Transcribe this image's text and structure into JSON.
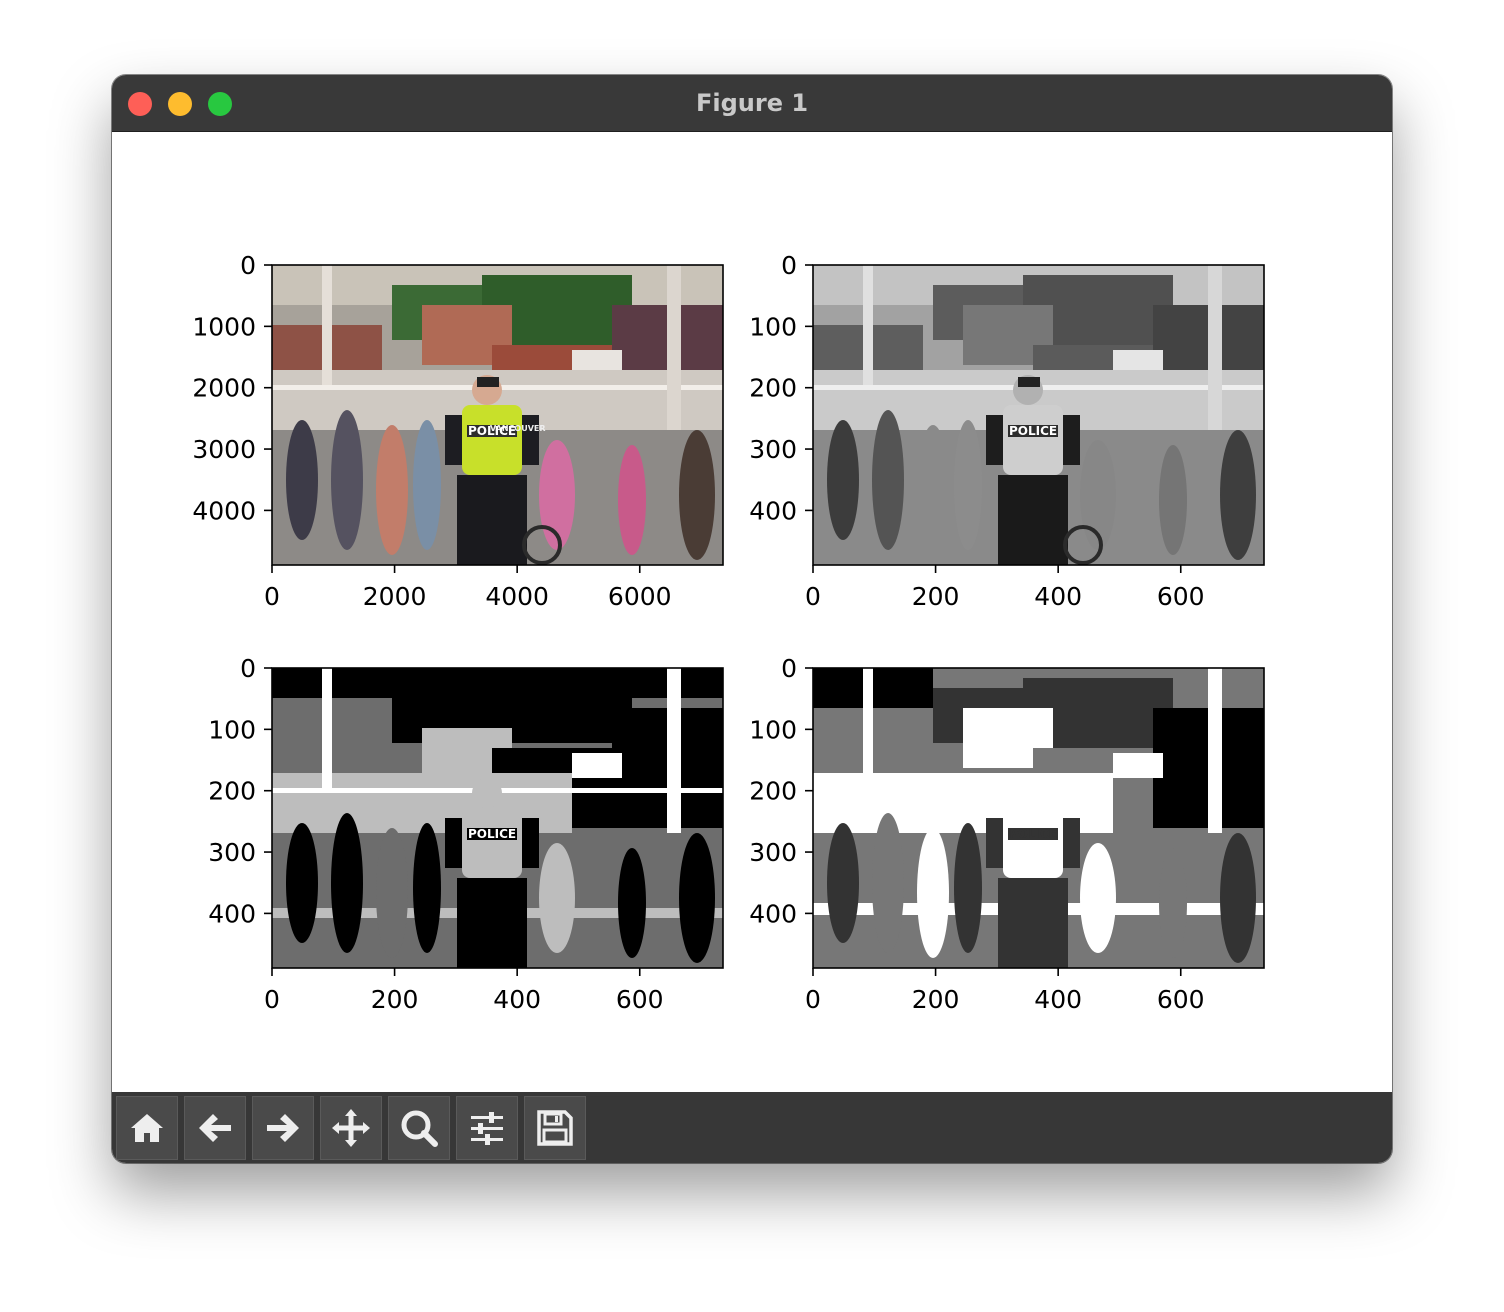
{
  "window": {
    "title": "Figure 1"
  },
  "toolbar": {
    "buttons": [
      {
        "name": "home-button",
        "icon": "home-icon"
      },
      {
        "name": "back-button",
        "icon": "arrow-left-icon"
      },
      {
        "name": "forward-button",
        "icon": "arrow-right-icon"
      },
      {
        "name": "pan-button",
        "icon": "move-icon"
      },
      {
        "name": "zoom-button",
        "icon": "magnifier-icon"
      },
      {
        "name": "configure-subplots-button",
        "icon": "sliders-icon"
      },
      {
        "name": "save-button",
        "icon": "floppy-disk-icon"
      }
    ]
  },
  "subplots": [
    {
      "image": "color photo: police officer in yellow vest among pedestrians",
      "x_ticks": [
        "0",
        "2000",
        "4000",
        "6000"
      ],
      "y_ticks": [
        "0",
        "1000",
        "2000",
        "3000",
        "4000"
      ]
    },
    {
      "image": "grayscale version of photo",
      "x_ticks": [
        "0",
        "200",
        "400",
        "600"
      ],
      "y_ticks": [
        "0",
        "100",
        "200",
        "300",
        "400"
      ]
    },
    {
      "image": "posterized grayscale (4 levels, dark)",
      "x_ticks": [
        "0",
        "200",
        "400",
        "600"
      ],
      "y_ticks": [
        "0",
        "100",
        "200",
        "300",
        "400"
      ]
    },
    {
      "image": "posterized grayscale (3 levels, light)",
      "x_ticks": [
        "0",
        "200",
        "400",
        "600"
      ],
      "y_ticks": [
        "0",
        "100",
        "200",
        "300",
        "400"
      ]
    }
  ],
  "vest_text": [
    "VANCOUVER",
    "POLICE"
  ]
}
